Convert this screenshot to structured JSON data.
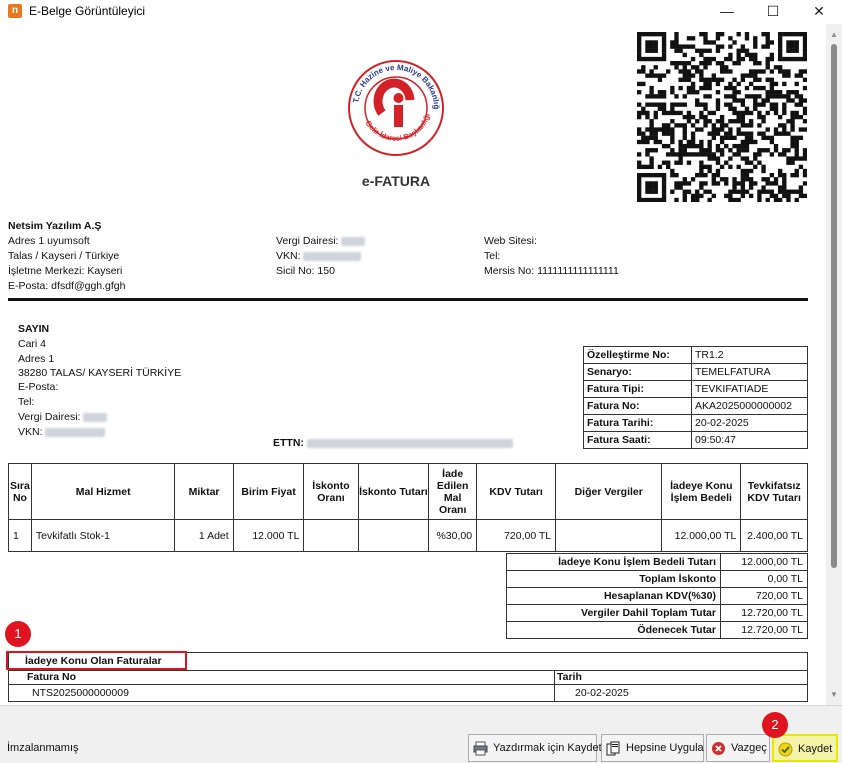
{
  "window": {
    "title": "E-Belge Görüntüleyici",
    "app_icon_letter": "n",
    "minimize": "—",
    "maximize": "☐",
    "close": "✕"
  },
  "document": {
    "doc_type": "e-FATURA",
    "logo_ring_text": "T.C. Hazine ve Maliye Bakanlığı · Gelir İdaresi Başkanlığı",
    "logo_mark": "Gi",
    "seller": {
      "name": "Netsim Yazılım A.Ş",
      "address1": "Adres 1 uyumsoft",
      "address2": " Talas / Kayseri / Türkiye",
      "office": "İşletme Merkezi: Kayseri",
      "email": "E-Posta:  dfsdf@ggh.gfgh",
      "tax_office_label": "Vergi Dairesi: ",
      "vkn_label": "VKN: ",
      "sicil": "Sicil No: 150",
      "web_label": "Web Sitesi:",
      "tel_label": "Tel:",
      "mersis": "Mersis No: 1111111111111111"
    },
    "buyer": {
      "sayin": "SAYIN",
      "name": "Cari 4",
      "address1": "Adres 1",
      "address2": "38280 TALAS/ KAYSERİ TÜRKİYE",
      "email_label": "E-Posta:",
      "tel_label": "Tel:",
      "tax_office_label": "Vergi Dairesi: ",
      "vkn_label": "VKN: "
    },
    "ettn_label": "ETTN:",
    "info_table": [
      {
        "key": "Özelleştirme No:",
        "value": "TR1.2"
      },
      {
        "key": "Senaryo:",
        "value": "TEMELFATURA"
      },
      {
        "key": "Fatura Tipi:",
        "value": "TEVKIFATIADE"
      },
      {
        "key": "Fatura No:",
        "value": "AKA2025000000002"
      },
      {
        "key": "Fatura Tarihi:",
        "value": "20-02-2025"
      },
      {
        "key": "Fatura Saati:",
        "value": "09:50:47"
      }
    ],
    "items_table": {
      "headers": [
        "Sıra No",
        "Mal Hizmet",
        "Miktar",
        "Birim Fiyat",
        "İskonto Oranı",
        "İskonto Tutarı",
        "İade Edilen Mal Oranı",
        "KDV Tutarı",
        "Diğer Vergiler",
        "İadeye Konu İşlem Bedeli",
        "Tevkifatsız KDV Tutarı"
      ],
      "rows": [
        [
          "1",
          "Tevkifatlı Stok-1",
          "1 Adet",
          "12.000 TL",
          "",
          "",
          "%30,00",
          "720,00 TL",
          "",
          "12.000,00 TL",
          "2.400,00 TL"
        ]
      ]
    },
    "totals": [
      {
        "key": "İadeye Konu İşlem Bedeli Tutarı",
        "value": "12.000,00 TL"
      },
      {
        "key": "Toplam İskonto",
        "value": "0,00 TL"
      },
      {
        "key": "Hesaplanan KDV(%30)",
        "value": "720,00 TL"
      },
      {
        "key": "Vergiler Dahil Toplam Tutar",
        "value": "12.720,00 TL"
      },
      {
        "key": "Ödenecek Tutar",
        "value": "12.720,00 TL"
      }
    ],
    "related_invoices": {
      "title": "İadeye Konu Olan Faturalar",
      "col_invoice_no": "Fatura No",
      "col_date": "Tarih",
      "rows": [
        {
          "invoice_no": "NTS2025000000009",
          "date": "20-02-2025"
        }
      ]
    }
  },
  "annotations": {
    "badge1": "1",
    "badge2": "2",
    "highlight_color": "#e0141e"
  },
  "bottom_bar": {
    "status": "İmzalanmamış",
    "buttons": [
      {
        "label": "Yazdırmak için Kaydet",
        "icon": "printer-icon"
      },
      {
        "label": "Hepsine Uygula",
        "icon": "documents-icon"
      },
      {
        "label": "Vazgeç",
        "icon": "cancel-icon"
      },
      {
        "label": "Kaydet",
        "icon": "check-icon"
      }
    ]
  }
}
